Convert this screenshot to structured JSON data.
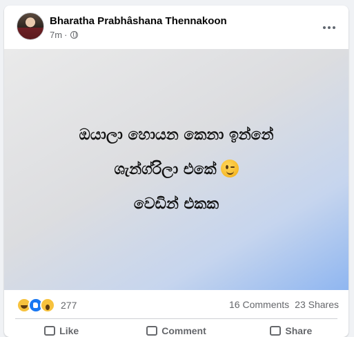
{
  "post": {
    "author": "Bharatha Prabhâshana Thennakoon",
    "time": "7m",
    "time_separator": "·",
    "image_text": {
      "line1": "ඔයාලා හොයන කෙනා ඉන්නේ",
      "line2": "ශැන්ග්රිලා එකේ",
      "line3": "වෙඩින් එකක"
    }
  },
  "stats": {
    "reactions": [
      "haha",
      "like",
      "wow"
    ],
    "reaction_count": "277",
    "comments": "16 Comments",
    "shares": "23 Shares"
  },
  "actions": [
    {
      "label": "Like",
      "icon": "like-icon"
    },
    {
      "label": "Comment",
      "icon": "comment-icon"
    },
    {
      "label": "Share",
      "icon": "share-icon"
    }
  ],
  "colors": {
    "accent": "#1877f2",
    "secondary_text": "#65676b",
    "background": "#f0f2f5"
  }
}
